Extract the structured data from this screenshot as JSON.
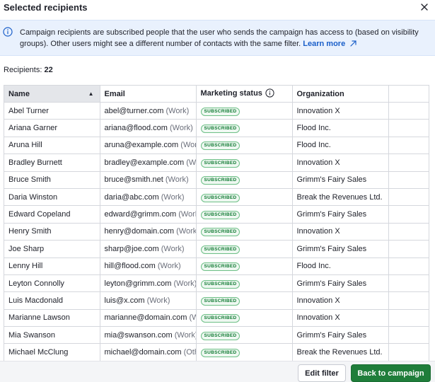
{
  "dialog": {
    "title": "Selected recipients"
  },
  "info": {
    "text": "Campaign recipients are subscribed people that the user who sends the campaign has access to (based on visibility groups). Other users might see a different number of contacts with the same filter.",
    "link_label": "Learn more"
  },
  "recipients": {
    "label": "Recipients:",
    "count": "22"
  },
  "table": {
    "columns": [
      "Name",
      "Email",
      "Marketing status",
      "Organization",
      ""
    ],
    "sorted_column": "Name",
    "sort_direction": "ascending",
    "rows": [
      {
        "name": "Abel Turner",
        "email": "abel@turner.com",
        "email_type": "(Work)",
        "status": "SUBSCRIBED",
        "organization": "Innovation X"
      },
      {
        "name": "Ariana Garner",
        "email": "ariana@flood.com",
        "email_type": "(Work)",
        "status": "SUBSCRIBED",
        "organization": "Flood Inc."
      },
      {
        "name": "Aruna Hill",
        "email": "aruna@example.com",
        "email_type": "(Work)",
        "status": "SUBSCRIBED",
        "organization": "Flood Inc."
      },
      {
        "name": "Bradley Burnett",
        "email": "bradley@example.com",
        "email_type": "(Work)",
        "status": "SUBSCRIBED",
        "organization": "Innovation X"
      },
      {
        "name": "Bruce Smith",
        "email": "bruce@smith.net",
        "email_type": "(Work)",
        "status": "SUBSCRIBED",
        "organization": "Grimm's Fairy Sales"
      },
      {
        "name": "Daria Winston",
        "email": "daria@abc.com",
        "email_type": "(Work)",
        "status": "SUBSCRIBED",
        "organization": "Break the Revenues Ltd."
      },
      {
        "name": "Edward Copeland",
        "email": "edward@grimm.com",
        "email_type": "(Work)",
        "status": "SUBSCRIBED",
        "organization": "Grimm's Fairy Sales"
      },
      {
        "name": "Henry Smith",
        "email": "henry@domain.com",
        "email_type": "(Work)",
        "status": "SUBSCRIBED",
        "organization": "Innovation X"
      },
      {
        "name": "Joe Sharp",
        "email": "sharp@joe.com",
        "email_type": "(Work)",
        "status": "SUBSCRIBED",
        "organization": "Grimm's Fairy Sales"
      },
      {
        "name": "Lenny Hill",
        "email": "hill@flood.com",
        "email_type": "(Work)",
        "status": "SUBSCRIBED",
        "organization": "Flood Inc."
      },
      {
        "name": "Leyton Connolly",
        "email": "leyton@grimm.com",
        "email_type": "(Work)",
        "status": "SUBSCRIBED",
        "organization": "Grimm's Fairy Sales"
      },
      {
        "name": "Luis Macdonald",
        "email": "luis@x.com",
        "email_type": "(Work)",
        "status": "SUBSCRIBED",
        "organization": "Innovation X"
      },
      {
        "name": "Marianne Lawson",
        "email": "marianne@domain.com",
        "email_type": "(Work)",
        "status": "SUBSCRIBED",
        "organization": "Innovation X"
      },
      {
        "name": "Mia Swanson",
        "email": "mia@swanson.com",
        "email_type": "(Work)",
        "status": "SUBSCRIBED",
        "organization": "Grimm's Fairy Sales"
      },
      {
        "name": "Michael McClung",
        "email": "michael@domain.com",
        "email_type": "(Other)",
        "status": "SUBSCRIBED",
        "organization": "Break the Revenues Ltd."
      }
    ]
  },
  "footer": {
    "edit_filter_label": "Edit filter",
    "back_label": "Back to campaign"
  },
  "colors": {
    "primary_button": "#1f7d3a",
    "link": "#1a5fc9",
    "info_background": "#e9f1fd",
    "subscribed_badge": "#0f7a32"
  },
  "icons": {
    "close": "close-icon",
    "info": "info-icon",
    "external_link": "external-link-icon",
    "sort": "sort-ascending-icon",
    "help": "help-circle-icon"
  }
}
